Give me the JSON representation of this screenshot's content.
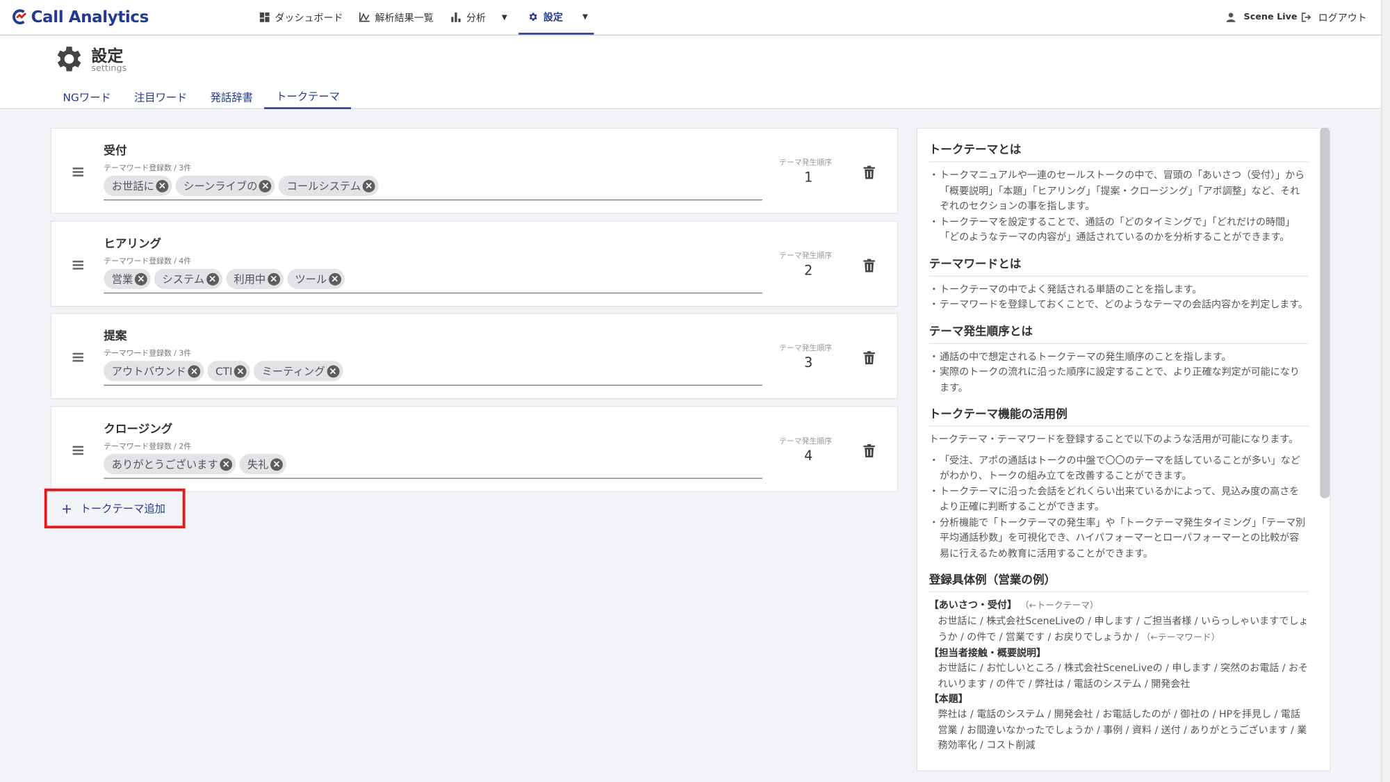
{
  "app": {
    "name": "Call Analytics",
    "brand_color": "#223a8f"
  },
  "nav": {
    "items": [
      {
        "label": "ダッシュボード",
        "icon": "dashboard-icon"
      },
      {
        "label": "解析結果一覧",
        "icon": "chart-line-icon"
      },
      {
        "label": "分析",
        "icon": "bar-chart-icon"
      },
      {
        "label": "設定",
        "icon": "gear-icon"
      }
    ],
    "user": "Scene Live",
    "logout": "ログアウト"
  },
  "page": {
    "title": "設定",
    "subtitle": "settings"
  },
  "tabs": [
    "NGワード",
    "注目ワード",
    "発話辞書",
    "トークテーマ"
  ],
  "themes": [
    {
      "title": "受付",
      "count_label": "テーマワード登録数 / 3件",
      "words": [
        "お世話に",
        "シーンライブの",
        "コールシステム"
      ],
      "order_label": "テーマ発生順序",
      "order": "1"
    },
    {
      "title": "ヒアリング",
      "count_label": "テーマワード登録数 / 4件",
      "words": [
        "営業",
        "システム",
        "利用中",
        "ツール"
      ],
      "order_label": "テーマ発生順序",
      "order": "2"
    },
    {
      "title": "提案",
      "count_label": "テーマワード登録数 / 3件",
      "words": [
        "アウトバウンド",
        "CTI",
        "ミーティング"
      ],
      "order_label": "テーマ発生順序",
      "order": "3"
    },
    {
      "title": "クロージング",
      "count_label": "テーマワード登録数 / 2件",
      "words": [
        "ありがとうございます",
        "失礼"
      ],
      "order_label": "テーマ発生順序",
      "order": "4"
    }
  ],
  "add_button": "トークテーマ追加",
  "help": {
    "s1_title": "トークテーマとは",
    "s1_items": [
      "トークマニュアルや一連のセールストークの中で、冒頭の「あいさつ（受付）」から「概要説明」「本題」「ヒアリング」「提案・クロージング」「アポ調整」など、それぞれのセクションの事を指します。",
      "トークテーマを設定することで、通話の「どのタイミングで」「どれだけの時間」「どのようなテーマの内容が」通話されているのかを分析することができます。"
    ],
    "s2_title": "テーマワードとは",
    "s2_items": [
      "トークテーマの中でよく発話される単語のことを指します。",
      "テーマワードを登録しておくことで、どのようなテーマの会話内容かを判定します。"
    ],
    "s3_title": "テーマ発生順序とは",
    "s3_items": [
      "通話の中で想定されるトークテーマの発生順序のことを指します。",
      "実際のトークの流れに沿った順序に設定することで、より正確な判定が可能になります。"
    ],
    "s4_title": "トークテーマ機能の活用例",
    "s4_intro": "トークテーマ・テーマワードを登録することで以下のような活用が可能になります。",
    "s4_items": [
      "「受注、アポの通話はトークの中盤で〇〇のテーマを話していることが多い」などがわかり、トークの組み立てを改善することができます。",
      "トークテーマに沿った会話をどれくらい出来ているかによって、見込み度の高さをより正確に判断することができます。",
      "分析機能で「トークテーマの発生率」や「トークテーマ発生タイミング」「テーマ別 平均通話秒数」を可視化でき、ハイパフォーマーとローパフォーマーとの比較が容易に行えるため教育に活用することができます。"
    ],
    "s5_title": "登録具体例（営業の例）",
    "ex1_head": "【あいさつ・受付】",
    "ex1_note": "（←トークテーマ）",
    "ex1_body": "お世話に / 株式会社SceneLiveの / 申します / ご担当者様 / いらっしゃいますでしょうか / の件で / 営業です / お戻りでしょうか /",
    "ex1_body_note": "（←テーマワード）",
    "ex2_head": "【担当者接触・概要説明】",
    "ex2_body": "お世話に / お忙しいところ / 株式会社SceneLiveの / 申します / 突然のお電話 / おそれいります / の件で / 弊社は / 電話のシステム / 開発会社",
    "ex3_head": "【本題】",
    "ex3_body": "弊社は / 電話のシステム / 開発会社 / お電話したのが / 御社の / HPを拝見し / 電話営業 / お間違いなかったでしょうか / 事例 / 資料 / 送付 / ありがとうございます / 業務効率化 / コスト削減"
  }
}
